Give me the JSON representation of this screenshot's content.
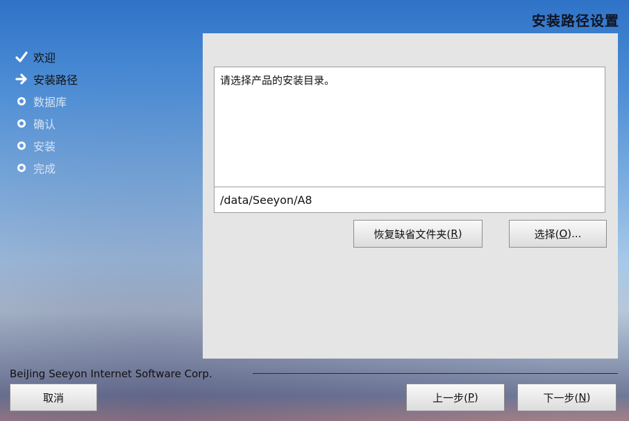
{
  "page": {
    "title": "安装路径设置"
  },
  "steps": [
    {
      "label": "欢迎",
      "state": "done",
      "icon": "check-icon"
    },
    {
      "label": "安装路径",
      "state": "current",
      "icon": "arrow-right-icon"
    },
    {
      "label": "数据库",
      "state": "pending",
      "icon": "circle-icon"
    },
    {
      "label": "确认",
      "state": "pending",
      "icon": "circle-icon"
    },
    {
      "label": "安装",
      "state": "pending",
      "icon": "circle-icon"
    },
    {
      "label": "完成",
      "state": "pending",
      "icon": "circle-icon"
    }
  ],
  "panel": {
    "description": "请选择产品的安装目录。",
    "install_path": "/data/Seeyon/A8",
    "restore_default_label": "恢复缺省文件夹(",
    "restore_default_mnemonic": "R",
    "choose_label": "选择(",
    "choose_mnemonic": "O",
    "choose_suffix": ")..."
  },
  "footer": {
    "company": "BeiJing Seeyon Internet Software Corp.",
    "cancel_label": "取消",
    "prev_label": "上一步(",
    "prev_mnemonic": "P",
    "next_label": "下一步(",
    "next_mnemonic": "N"
  },
  "colors": {
    "panel_bg": "#e5e5e5",
    "pending_step_text": "#d8e4f2",
    "active_step_text": "#111111"
  }
}
